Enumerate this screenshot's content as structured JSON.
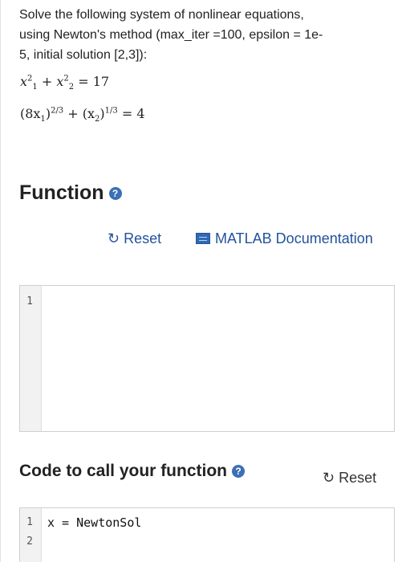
{
  "problem": {
    "line1": "Solve the following system of nonlinear equations,",
    "line2": "using Newton's method (max_iter =100, epsilon = 1e-",
    "line3": "5, initial solution [2,3]):"
  },
  "equations": {
    "eq1": {
      "x1": "x",
      "sup1": "2",
      "sub1": "1",
      "plus": " + ",
      "x2": "x",
      "sup2": "2",
      "sub2": "2",
      "rhs": " = 17"
    },
    "eq2": {
      "part1": "(8x",
      "sub1": "1",
      "part2": ")",
      "sup1": "2/3",
      "plus": " + (x",
      "sub2": "2",
      "part3": ")",
      "sup2": "1/3",
      "rhs": " = 4"
    }
  },
  "function_section": {
    "title": "Function",
    "help_icon": "question-circle",
    "reset_label": "Reset",
    "doc_label": "MATLAB Documentation",
    "line_numbers": [
      "1"
    ],
    "code_lines": [
      ""
    ]
  },
  "call_section": {
    "title": "Code to call your function",
    "help_icon": "question-circle",
    "reset_label": "Reset",
    "line_numbers": [
      "1",
      "2"
    ],
    "code_lines": [
      "x = NewtonSol",
      ""
    ]
  },
  "colors": {
    "link": "#22539b",
    "help_icon": "#3b6fb6",
    "gutter": "#f2f2f2",
    "border": "#cfcfcf"
  }
}
